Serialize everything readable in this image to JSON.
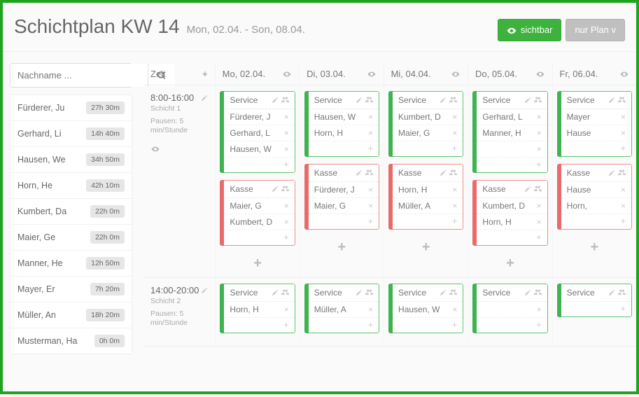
{
  "header": {
    "title": "Schichtplan KW 14",
    "subtitle": "Mon, 02.04. - Son, 08.04.",
    "visible_btn": "sichtbar",
    "plan_btn": "nur Plan v"
  },
  "search": {
    "placeholder": "Nachname ..."
  },
  "employees": [
    {
      "name": "Fürderer, Ju",
      "hours": "27h 30m"
    },
    {
      "name": "Gerhard, Li",
      "hours": "14h 40m"
    },
    {
      "name": "Hausen, We",
      "hours": "34h 50m"
    },
    {
      "name": "Horn, He",
      "hours": "42h 10m"
    },
    {
      "name": "Kumbert, Da",
      "hours": "22h 0m"
    },
    {
      "name": "Maier, Ge",
      "hours": "22h 0m"
    },
    {
      "name": "Manner, He",
      "hours": "12h 50m"
    },
    {
      "name": "Mayer, Er",
      "hours": "7h 20m"
    },
    {
      "name": "Müller, An",
      "hours": "18h 20m"
    },
    {
      "name": "Musterman, Ha",
      "hours": "0h 0m"
    }
  ],
  "columns": {
    "time": "Zeit",
    "days": [
      "Mo, 02.04.",
      "Di, 03.04.",
      "Mi, 04.04.",
      "Do, 05.04.",
      "Fr, 06.04."
    ]
  },
  "rows": [
    {
      "time": "8:00-16:00",
      "shift": "Schicht 1",
      "pause": "Pausen: 5 min/Stunde",
      "days": [
        [
          {
            "type": "green",
            "title": "Service",
            "people": [
              "Fürderer, J",
              "Gerhard, L",
              "Hausen, W"
            ]
          },
          {
            "type": "red",
            "title": "Kasse",
            "people": [
              "Maier, G",
              "Kumbert, D"
            ]
          }
        ],
        [
          {
            "type": "green",
            "title": "Service",
            "people": [
              "Hausen, W",
              "Horn, H"
            ]
          },
          {
            "type": "red",
            "title": "Kasse",
            "people": [
              "Fürderer, J",
              "Maier, G"
            ]
          }
        ],
        [
          {
            "type": "green",
            "title": "Service",
            "people": [
              "Kumbert, D",
              "Maier, G"
            ]
          },
          {
            "type": "red",
            "title": "Kasse",
            "people": [
              "Horn, H",
              "Müller, A"
            ]
          }
        ],
        [
          {
            "type": "green",
            "title": "Service",
            "people": [
              "Gerhard, L",
              "Manner, H",
              ""
            ]
          },
          {
            "type": "red",
            "title": "Kasse",
            "people": [
              "Kumbert, D",
              "Horn, H"
            ]
          }
        ],
        [
          {
            "type": "green",
            "title": "Service",
            "people": [
              "Mayer",
              "Hause"
            ]
          },
          {
            "type": "red",
            "title": "Kasse",
            "people": [
              "Hause",
              "Horn,"
            ]
          }
        ]
      ]
    },
    {
      "time": "14:00-20:00",
      "shift": "Schicht 2",
      "pause": "Pausen: 5 min/Stunde",
      "days": [
        [
          {
            "type": "green",
            "title": "Service",
            "people": [
              "Horn, H"
            ]
          }
        ],
        [
          {
            "type": "green",
            "title": "Service",
            "people": [
              "Müller, A"
            ]
          }
        ],
        [
          {
            "type": "green",
            "title": "Service",
            "people": [
              "Hausen, W"
            ]
          }
        ],
        [
          {
            "type": "green",
            "title": "Service",
            "people": [
              ""
            ]
          }
        ],
        [
          {
            "type": "green",
            "title": "Service",
            "people": []
          }
        ]
      ]
    }
  ]
}
